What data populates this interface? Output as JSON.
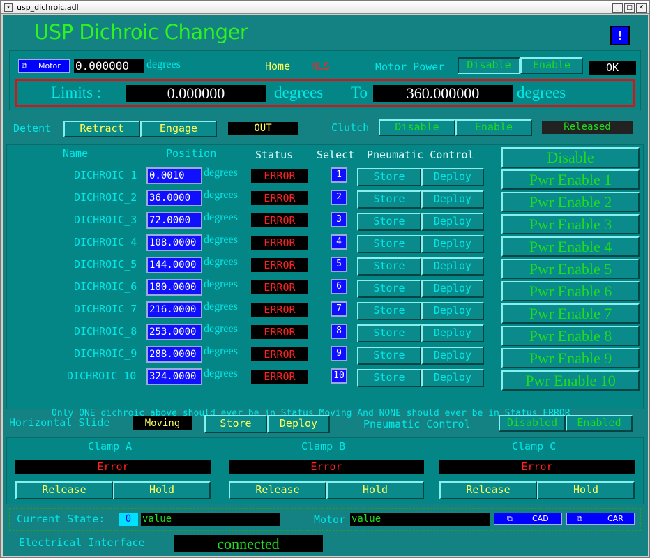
{
  "window": {
    "title": "usp_dichroic.adl",
    "menu_glyph": "▾",
    "min_glyph": "_",
    "max_glyph": "□",
    "close_glyph": "✕"
  },
  "header": {
    "title": "USP Dichroic Changer",
    "help_label": "!"
  },
  "motor": {
    "related_label": "Motor",
    "related_icon": "⧉",
    "value": "0.000000",
    "units": "degrees",
    "home_label": "Home",
    "hls_label": "HLS",
    "power_label": "Motor Power",
    "disable_label": "Disable",
    "enable_label": "Enable",
    "status": "OK",
    "limits_label": "Limits :",
    "limit_low": "0.000000",
    "limit_low_units": "degrees",
    "to_label": "To",
    "limit_high": "360.000000",
    "limit_high_units": "degrees"
  },
  "detent": {
    "label": "Detent",
    "retract_label": "Retract",
    "engage_label": "Engage",
    "status": "OUT",
    "clutch_label": "Clutch",
    "clutch_disable": "Disable",
    "clutch_enable": "Enable",
    "clutch_status": "Released"
  },
  "table": {
    "col_name": "Name",
    "col_position": "Position",
    "col_status": "Status",
    "col_select": "Select",
    "col_pneumatic": "Pneumatic Control",
    "units": "degrees",
    "store_label": "Store",
    "deploy_label": "Deploy",
    "pwr_disable": "Disable",
    "rows": [
      {
        "name": "DICHROIC_1",
        "position": "0.0010",
        "status": "ERROR",
        "select": "1",
        "pwr": "Pwr Enable 1"
      },
      {
        "name": "DICHROIC_2",
        "position": "36.0000",
        "status": "ERROR",
        "select": "2",
        "pwr": "Pwr Enable 2"
      },
      {
        "name": "DICHROIC_3",
        "position": "72.0000",
        "status": "ERROR",
        "select": "3",
        "pwr": "Pwr Enable 3"
      },
      {
        "name": "DICHROIC_4",
        "position": "108.0000",
        "status": "ERROR",
        "select": "4",
        "pwr": "Pwr Enable 4"
      },
      {
        "name": "DICHROIC_5",
        "position": "144.0000",
        "status": "ERROR",
        "select": "5",
        "pwr": "Pwr Enable 5"
      },
      {
        "name": "DICHROIC_6",
        "position": "180.0000",
        "status": "ERROR",
        "select": "6",
        "pwr": "Pwr Enable 6"
      },
      {
        "name": "DICHROIC_7",
        "position": "216.0000",
        "status": "ERROR",
        "select": "7",
        "pwr": "Pwr Enable 7"
      },
      {
        "name": "DICHROIC_8",
        "position": "253.0000",
        "status": "ERROR",
        "select": "8",
        "pwr": "Pwr Enable 8"
      },
      {
        "name": "DICHROIC_9",
        "position": "288.0000",
        "status": "ERROR",
        "select": "9",
        "pwr": "Pwr Enable 9"
      },
      {
        "name": "DICHROIC_10",
        "position": "324.0000",
        "status": "ERROR",
        "select": "10",
        "pwr": "Pwr Enable 10"
      }
    ],
    "note": "Only ONE dichroic above should ever be in Status Moving And NONE should ever be in Status ERROR"
  },
  "slide": {
    "label": "Horizontal Slide",
    "status": "Moving",
    "store_label": "Store",
    "deploy_label": "Deploy",
    "pneumatic_label": "Pneumatic Control",
    "disabled_label": "Disabled",
    "enabled_label": "Enabled"
  },
  "clamps": [
    {
      "title": "Clamp A",
      "status": "Error",
      "release": "Release",
      "hold": "Hold"
    },
    {
      "title": "Clamp B",
      "status": "Error",
      "release": "Release",
      "hold": "Hold"
    },
    {
      "title": "Clamp C",
      "status": "Error",
      "release": "Release",
      "hold": "Hold"
    }
  ],
  "state": {
    "label": "Current State:",
    "index": "0",
    "value": "value",
    "motor_label": "Motor",
    "motor_value": "value",
    "cad_label": "CAD",
    "car_label": "CAR",
    "related_icon": "⧉"
  },
  "interface": {
    "label": "Electrical Interface",
    "status": "connected"
  },
  "colors": {
    "background": "#148282",
    "green_text": "#2ef31e",
    "cyan_text": "#38e0e0",
    "yellow_text": "#ffff5a",
    "error_red": "#ff2222",
    "entry_blue": "#1010ff",
    "limits_border": "#e01010"
  }
}
